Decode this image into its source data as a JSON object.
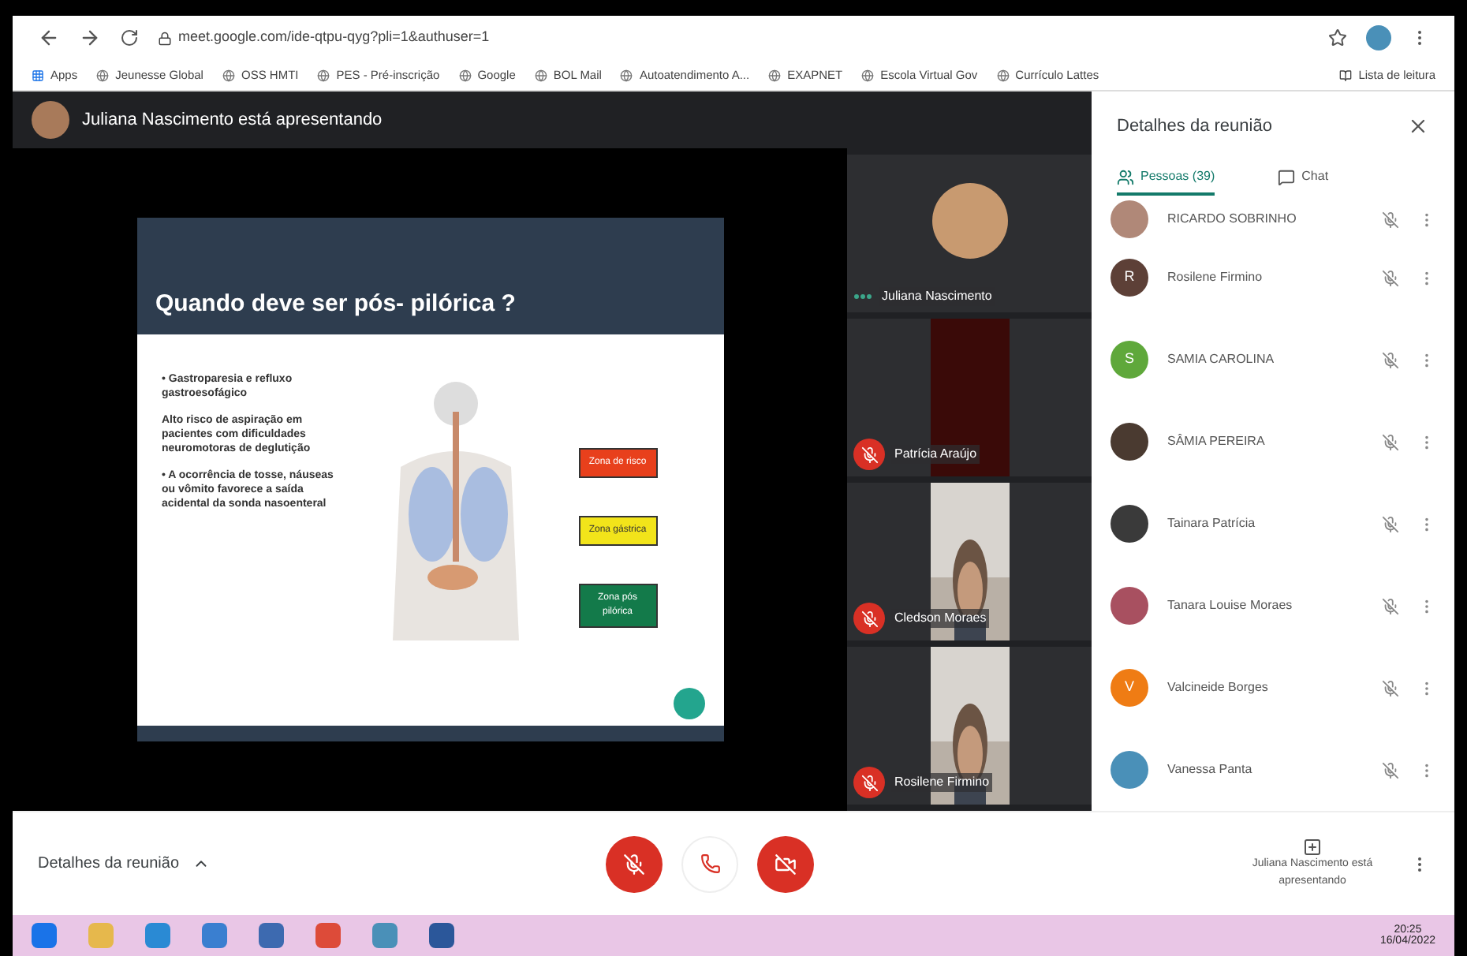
{
  "browser": {
    "url": "meet.google.com/ide-qtpu-qyg?pli=1&authuser=1",
    "bookmarks": [
      "Apps",
      "Jeunesse Global",
      "OSS HMTI",
      "PES - Pré-inscrição",
      "Google",
      "BOL Mail",
      "Autoatendimento A...",
      "EXAPNET",
      "Escola Virtual Gov",
      "Currículo Lattes"
    ],
    "reading_list": "Lista de leitura"
  },
  "presenter_banner": "Juliana Nascimento está apresentando",
  "slide": {
    "title": "Quando deve ser pós- pilórica ?",
    "paragraphs": [
      "• Gastroparesia e refluxo gastroesofágico",
      "Alto risco de aspiração em pacientes com dificuldades neuromotoras de deglutição",
      "• A ocorrência de tosse, náuseas ou vômito favorece a saída acidental da sonda nasoenteral"
    ],
    "zones": [
      {
        "label": "Zona de risco",
        "color": "#e8401c"
      },
      {
        "label": "Zona gástrica",
        "color": "#f2e41a"
      },
      {
        "label": "Zona pós pilórica",
        "color": "#137a4a"
      }
    ]
  },
  "tiles": [
    {
      "name": "Juliana Nascimento",
      "kind": "avatar",
      "muted": false
    },
    {
      "name": "Patrícia Araújo",
      "kind": "dark",
      "muted": true
    },
    {
      "name": "Cledson Moraes",
      "kind": "video",
      "muted": true
    },
    {
      "name": "Rosilene Firmino",
      "kind": "video",
      "muted": true
    }
  ],
  "panel": {
    "title": "Detalhes da reunião",
    "tabs": [
      {
        "label": "Pessoas (39)",
        "selected": true
      },
      {
        "label": "Chat",
        "selected": false
      }
    ],
    "people": [
      {
        "name": "RICARDO SOBRINHO",
        "color": "#b08878"
      },
      {
        "name": "Rosilene Firmino",
        "kind": "letter",
        "initial": "R",
        "color": "#5d4037"
      },
      {
        "name": "SAMIA CAROLINA",
        "kind": "letter",
        "initial": "S",
        "color": "#5fa83b"
      },
      {
        "name": "SÂMIA PEREIRA",
        "color": "#4a3a30"
      },
      {
        "name": "Tainara Patrícia",
        "color": "#3a3a3a"
      },
      {
        "name": "Tanara Louise Moraes",
        "color": "#a85060"
      },
      {
        "name": "Valcineide Borges",
        "kind": "letter",
        "initial": "V",
        "color": "#ef7c14"
      },
      {
        "name": "Vanessa Panta",
        "color": "#4a90b8"
      }
    ]
  },
  "bottom": {
    "details": "Detalhes da reunião",
    "presenting": "Juliana Nascimento está apresentando"
  },
  "taskbar": {
    "time": "20:25",
    "date": "16/04/2022"
  }
}
